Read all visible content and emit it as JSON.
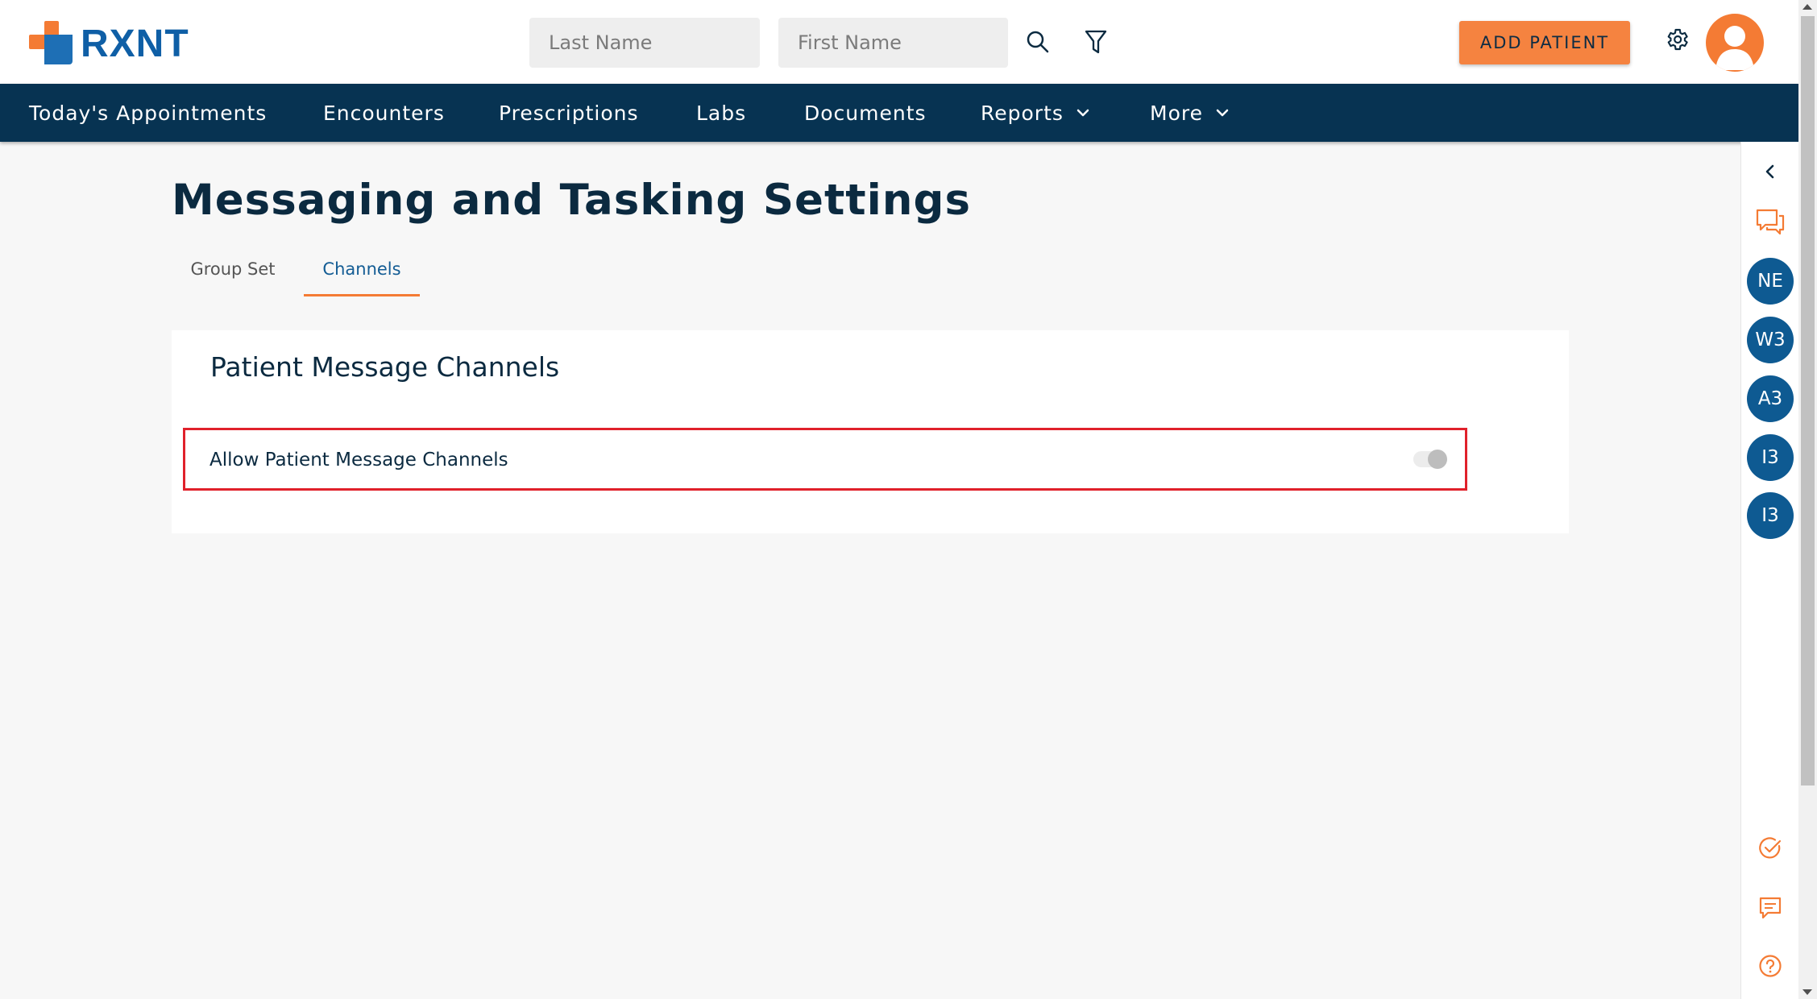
{
  "header": {
    "logo_text": "RXNT",
    "last_name_placeholder": "Last Name",
    "first_name_placeholder": "First Name",
    "add_patient_label": "ADD PATIENT",
    "icons": [
      "search-icon",
      "filter-icon",
      "gear-icon",
      "user-avatar-icon"
    ]
  },
  "nav": {
    "items": [
      {
        "label": "Today's Appointments"
      },
      {
        "label": "Encounters"
      },
      {
        "label": "Prescriptions"
      },
      {
        "label": "Labs"
      },
      {
        "label": "Documents"
      },
      {
        "label": "Reports",
        "has_dropdown": true
      },
      {
        "label": "More",
        "has_dropdown": true
      }
    ]
  },
  "page": {
    "title": "Messaging and Tasking Settings",
    "tabs": [
      {
        "label": "Group Set",
        "active": false
      },
      {
        "label": "Channels",
        "active": true
      }
    ]
  },
  "card": {
    "title": "Patient Message Channels",
    "setting_label": "Allow Patient Message Channels",
    "toggle_on": false
  },
  "rail": {
    "collapse_icon": "chevron-left-icon",
    "chat_icon": "chat-bubbles-icon",
    "initials": [
      "NE",
      "W3",
      "A3",
      "I3",
      "I3"
    ],
    "bottom_icons": [
      "check-circle-icon",
      "message-icon",
      "help-icon"
    ]
  },
  "colors": {
    "primary_navy": "#073352",
    "accent_orange": "#f58340",
    "brand_blue": "#0e5a92",
    "highlight_red": "#e0212b"
  }
}
